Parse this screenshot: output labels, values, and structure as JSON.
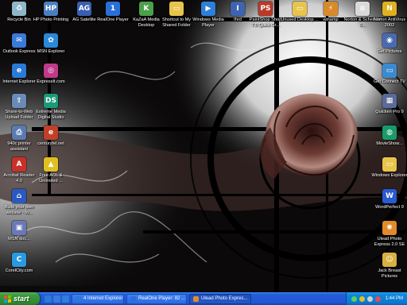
{
  "desktop_icons": [
    {
      "label": "Recycle Bin",
      "icon": "recycle-bin-icon",
      "color": "#8fb7c9",
      "glyph": "♻"
    },
    {
      "label": "HP Photo Printing",
      "icon": "hp-photo-icon",
      "color": "#4a7fc0",
      "glyph": "HP"
    },
    {
      "label": "AG Satellite",
      "icon": "satellite-icon",
      "color": "#3a5fb0",
      "glyph": "AG"
    },
    {
      "label": "RealOne Player",
      "icon": "realone-icon",
      "color": "#2a6fd8",
      "glyph": "1"
    },
    {
      "label": "KaZaA Media Desktop",
      "icon": "kazaa-icon",
      "color": "#4ca04a",
      "glyph": "K"
    },
    {
      "label": "Shortcut to My Shared Folder",
      "icon": "folder-icon",
      "color": "#e8c44a",
      "glyph": "▭"
    },
    {
      "label": "Windows Media Player",
      "icon": "media-player-icon",
      "color": "#2d7fd8",
      "glyph": "▶"
    },
    {
      "label": "Ihrd",
      "icon": "program-icon",
      "color": "#3d64b0",
      "glyph": "I"
    },
    {
      "label": "PaintShop Shop 7.0 Quick Gr...",
      "icon": "paintshop-icon",
      "color": "#b83a2a",
      "glyph": "PS"
    },
    {
      "label": "Unused Desktop ...",
      "icon": "folder-icon",
      "color": "#e8c44a",
      "glyph": "▭"
    },
    {
      "label": "winamp",
      "icon": "winamp-icon",
      "color": "#d88a2a",
      "glyph": "⚡"
    },
    {
      "label": "Norton & Schedule 6...",
      "icon": "document-icon",
      "color": "#d9d9d9",
      "glyph": "≡"
    },
    {
      "label": "Norton AntiVirus 2002",
      "icon": "antivirus-icon",
      "color": "#e0b020",
      "glyph": "N"
    },
    {
      "label": "Outlook Express",
      "icon": "outlook-icon",
      "color": "#3a7ad8",
      "glyph": "✉"
    },
    {
      "label": "MSN Explorer",
      "icon": "msn-icon",
      "color": "#2b88d8",
      "glyph": "✿"
    },
    {
      "label": "Internet Explorer",
      "icon": "internet-explorer-icon",
      "color": "#2a7ad8",
      "glyph": "e"
    },
    {
      "label": "ExpressIt.com",
      "icon": "expressit-icon",
      "color": "#c03a8a",
      "glyph": "◎"
    },
    {
      "label": "Share-to-Web Upload Folder",
      "icon": "upload-folder-icon",
      "color": "#6a8ab8",
      "glyph": "⇪"
    },
    {
      "label": "Extreme Media Digital Studio",
      "icon": "digital-studio-icon",
      "color": "#1a9a7a",
      "glyph": "DS"
    },
    {
      "label": "940c printer assistant",
      "icon": "printer-icon",
      "color": "#5a7ab0",
      "glyph": "⎙"
    },
    {
      "label": "centurytel.net",
      "icon": "centurytel-icon",
      "color": "#c0402a",
      "glyph": "e"
    },
    {
      "label": "Acrobat Reader 4.0",
      "icon": "acrobat-icon",
      "color": "#c8302a",
      "glyph": "A"
    },
    {
      "label": "Free AOL & Unlimited ...",
      "icon": "aol-icon",
      "color": "#e0c020",
      "glyph": "▲"
    },
    {
      "label": "Build your own website - fo...",
      "icon": "website-icon",
      "color": "#2a5ac0",
      "glyph": "⌂"
    },
    {
      "label": "MSN doc...",
      "icon": "msn-doc-icon",
      "color": "#6a7ab8",
      "glyph": "▣"
    },
    {
      "label": "CorelCity.com",
      "icon": "corel-icon",
      "color": "#2a9ae0",
      "glyph": "C"
    },
    {
      "label": "Get Pictures",
      "icon": "camera-icon",
      "color": "#4a6ab0",
      "glyph": "◉"
    },
    {
      "label": "Get Connect TV",
      "icon": "tv-icon",
      "color": "#3a8ad0",
      "glyph": "▭"
    },
    {
      "label": "Quicken Pro 9",
      "icon": "calculator-icon",
      "color": "#5a6a9a",
      "glyph": "▦"
    },
    {
      "label": "MovieShow...",
      "icon": "movie-icon",
      "color": "#1a9a6a",
      "glyph": "◍"
    },
    {
      "label": "Windows Explorer",
      "icon": "explorer-icon",
      "color": "#e8c44a",
      "glyph": "▭"
    },
    {
      "label": "WordPerfect 9",
      "icon": "wordperfect-icon",
      "color": "#2a5ad0",
      "glyph": "W"
    },
    {
      "label": "Ulead Photo Express 2.0 SE",
      "icon": "ulead-icon",
      "color": "#e08a2a",
      "glyph": "✺"
    },
    {
      "label": "Jack Breast Pictures",
      "icon": "people-icon",
      "color": "#d8b040",
      "glyph": "☺"
    }
  ],
  "taskbar": {
    "start_label": "start",
    "tasks": [
      {
        "label": "4 Internet Explorer",
        "icon": "internet-explorer-icon",
        "color": "#2a7ad8"
      },
      {
        "label": "RealOne Player: 82 ...",
        "icon": "realone-icon",
        "color": "#2a6fd8"
      },
      {
        "label": "Ulead Photo Expres...",
        "icon": "ulead-icon",
        "color": "#e08a2a"
      }
    ],
    "clock": "1:44 PM"
  },
  "colors": {
    "taskbar": "#245edb",
    "start": "#3c9a3c",
    "tray": "#0f85dc"
  }
}
